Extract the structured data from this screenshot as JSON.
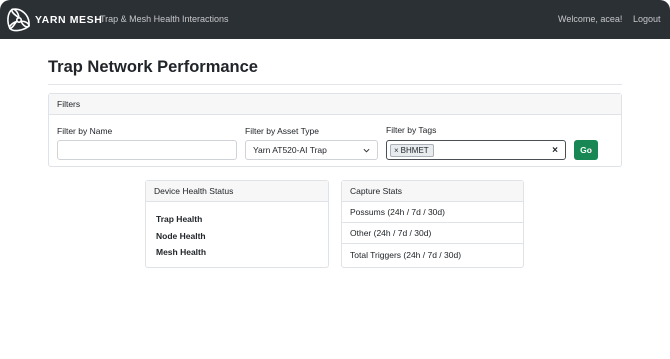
{
  "navbar": {
    "brand": "YARN MESH",
    "links": [
      "Trap & Mesh Health",
      "Interactions"
    ],
    "welcome": "Welcome, acea!",
    "logout": "Logout",
    "logo_icon": "triskelion-logo-icon"
  },
  "page": {
    "title": "Trap Network Performance"
  },
  "filters": {
    "header": "Filters",
    "name_label": "Filter by Name",
    "name_value": "",
    "asset_label": "Filter by Asset Type",
    "asset_selected": "Yarn AT520-AI Trap",
    "tags_label": "Filter by Tags",
    "tags": [
      "BHMET"
    ],
    "clear_icon": "×",
    "go_label": "Go"
  },
  "device_health": {
    "header": "Device Health Status",
    "items": [
      "Trap Health",
      "Node Health",
      "Mesh Health"
    ]
  },
  "capture_stats": {
    "header": "Capture Stats",
    "rows": [
      "Possums (24h / 7d / 30d)",
      "Other (24h / 7d / 30d)",
      "Total Triggers (24h / 7d / 30d)"
    ]
  },
  "colors": {
    "navbar_bg": "#2b3035",
    "go_button": "#198754"
  }
}
